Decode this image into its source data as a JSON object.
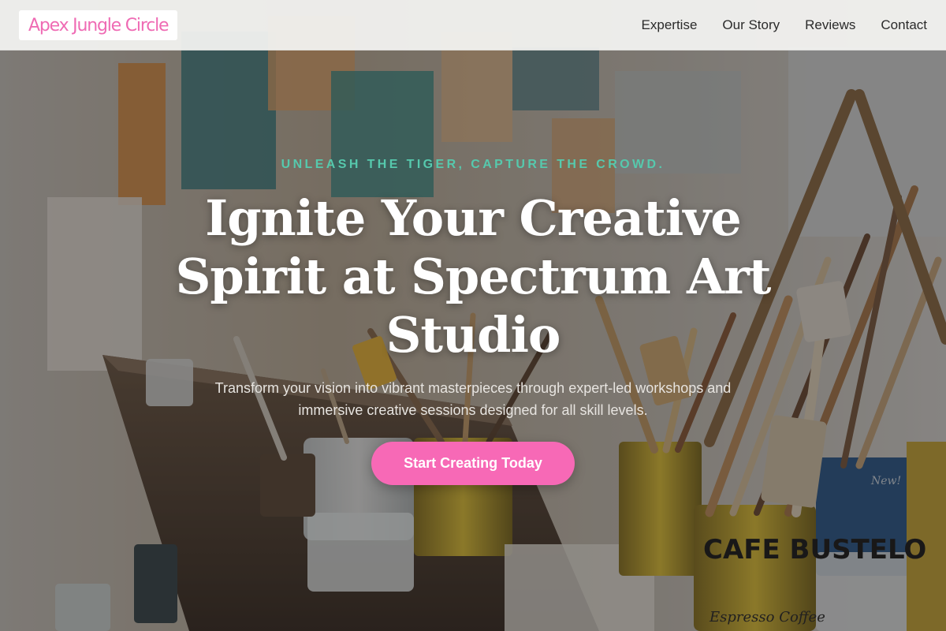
{
  "brand": {
    "logo_text": "Apex Jungle Circle",
    "accent_color": "#f769b6",
    "eyebrow_color": "#56c9ad"
  },
  "nav": {
    "items": [
      {
        "label": "Expertise"
      },
      {
        "label": "Our Story"
      },
      {
        "label": "Reviews"
      },
      {
        "label": "Contact"
      }
    ]
  },
  "hero": {
    "eyebrow": "UNLEASH THE TIGER, CAPTURE THE CROWD.",
    "headline": "Ignite Your Creative Spirit at Spectrum Art Studio",
    "subtext": "Transform your vision into vibrant masterpieces through expert-led workshops and immersive creative sessions designed for all skill levels.",
    "cta_label": "Start Creating Today",
    "background_image": "art-studio-brushes-photo",
    "background_text": {
      "can_brand": "CAFE BUSTELO",
      "can_subtitle": "Espresso Coffee",
      "small_can_label": "New!"
    }
  }
}
